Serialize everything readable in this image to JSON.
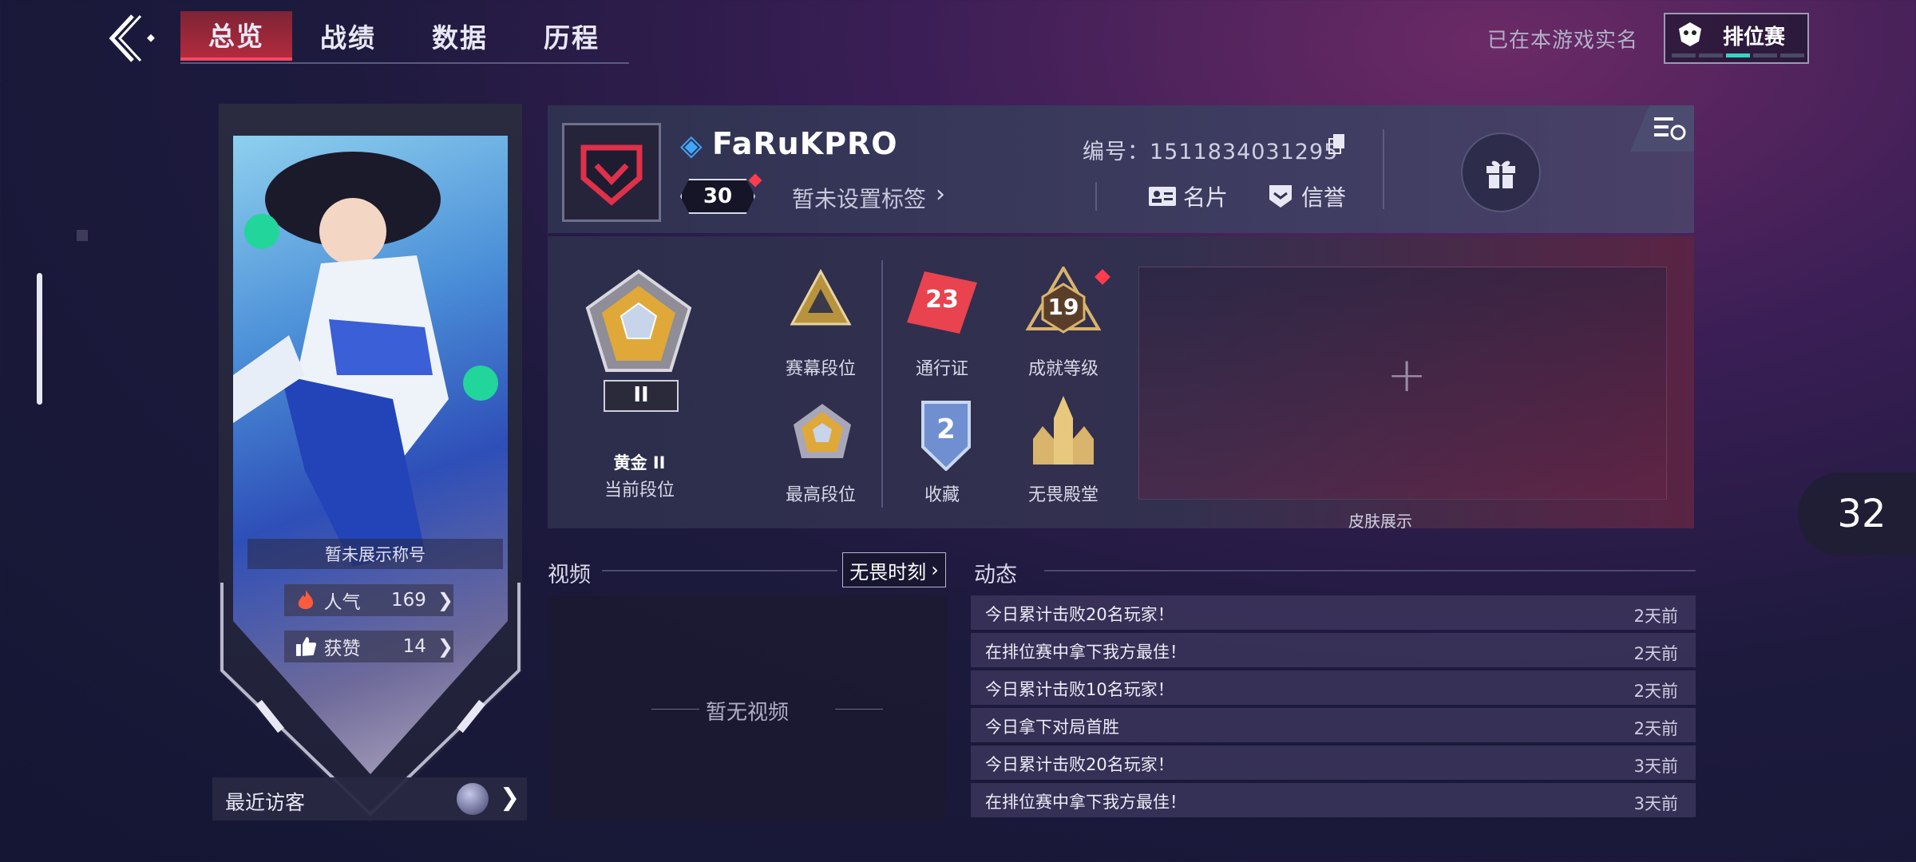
{
  "nav": {
    "tabs": [
      {
        "label": "总览",
        "active": true
      },
      {
        "label": "战绩"
      },
      {
        "label": "数据"
      },
      {
        "label": "历程"
      }
    ],
    "realname_text": "已在本游戏实名",
    "ranked_label": "排位赛"
  },
  "banner": {
    "title_plate": "暂未展示称号",
    "popularity": {
      "label": "人气",
      "value": "169"
    },
    "likes": {
      "label": "获赞",
      "value": "14"
    },
    "recent_visitors": "最近访客"
  },
  "profile": {
    "nickname": "FaRuKPRO",
    "level": "30",
    "tagline": "暂未设置标签",
    "id_label": "编号：1511834031295",
    "card_label": "名片",
    "reputation_label": "信誉"
  },
  "ranks": {
    "current_rank_name": "黄金 II",
    "current_rank_label": "当前段位",
    "season_rank": "赛幕段位",
    "highest_rank": "最高段位",
    "pass_label": "通行证",
    "pass_value": "23",
    "collection_label": "收藏",
    "collection_value": "2",
    "achievement_label": "成就等级",
    "achievement_value": "19",
    "hall_label": "无畏殿堂",
    "skin_label": "皮肤展示",
    "rank_numeral": "II"
  },
  "video": {
    "title": "视频",
    "moment_btn": "无畏时刻",
    "empty_text": "暂无视频"
  },
  "feed": {
    "title": "动态",
    "items": [
      {
        "text": "今日累计击败20名玩家！",
        "time": "2天前"
      },
      {
        "text": "在排位赛中拿下我方最佳！",
        "time": "2天前"
      },
      {
        "text": "今日累计击败10名玩家！",
        "time": "2天前"
      },
      {
        "text": "今日拿下对局首胜",
        "time": "2天前"
      },
      {
        "text": "今日累计击败20名玩家！",
        "time": "3天前"
      },
      {
        "text": "在排位赛中拿下我方最佳！",
        "time": "3天前"
      }
    ]
  },
  "page_number": "32",
  "colors": {
    "accent": "#ff4760",
    "teal": "#35d6c0",
    "nick_icon": "#3ea7ff"
  },
  "icons": [
    "back-icon",
    "gift-icon",
    "fire-icon",
    "thumb-up-icon",
    "card-icon",
    "shield-icon",
    "copy-icon",
    "settings-list-icon"
  ]
}
